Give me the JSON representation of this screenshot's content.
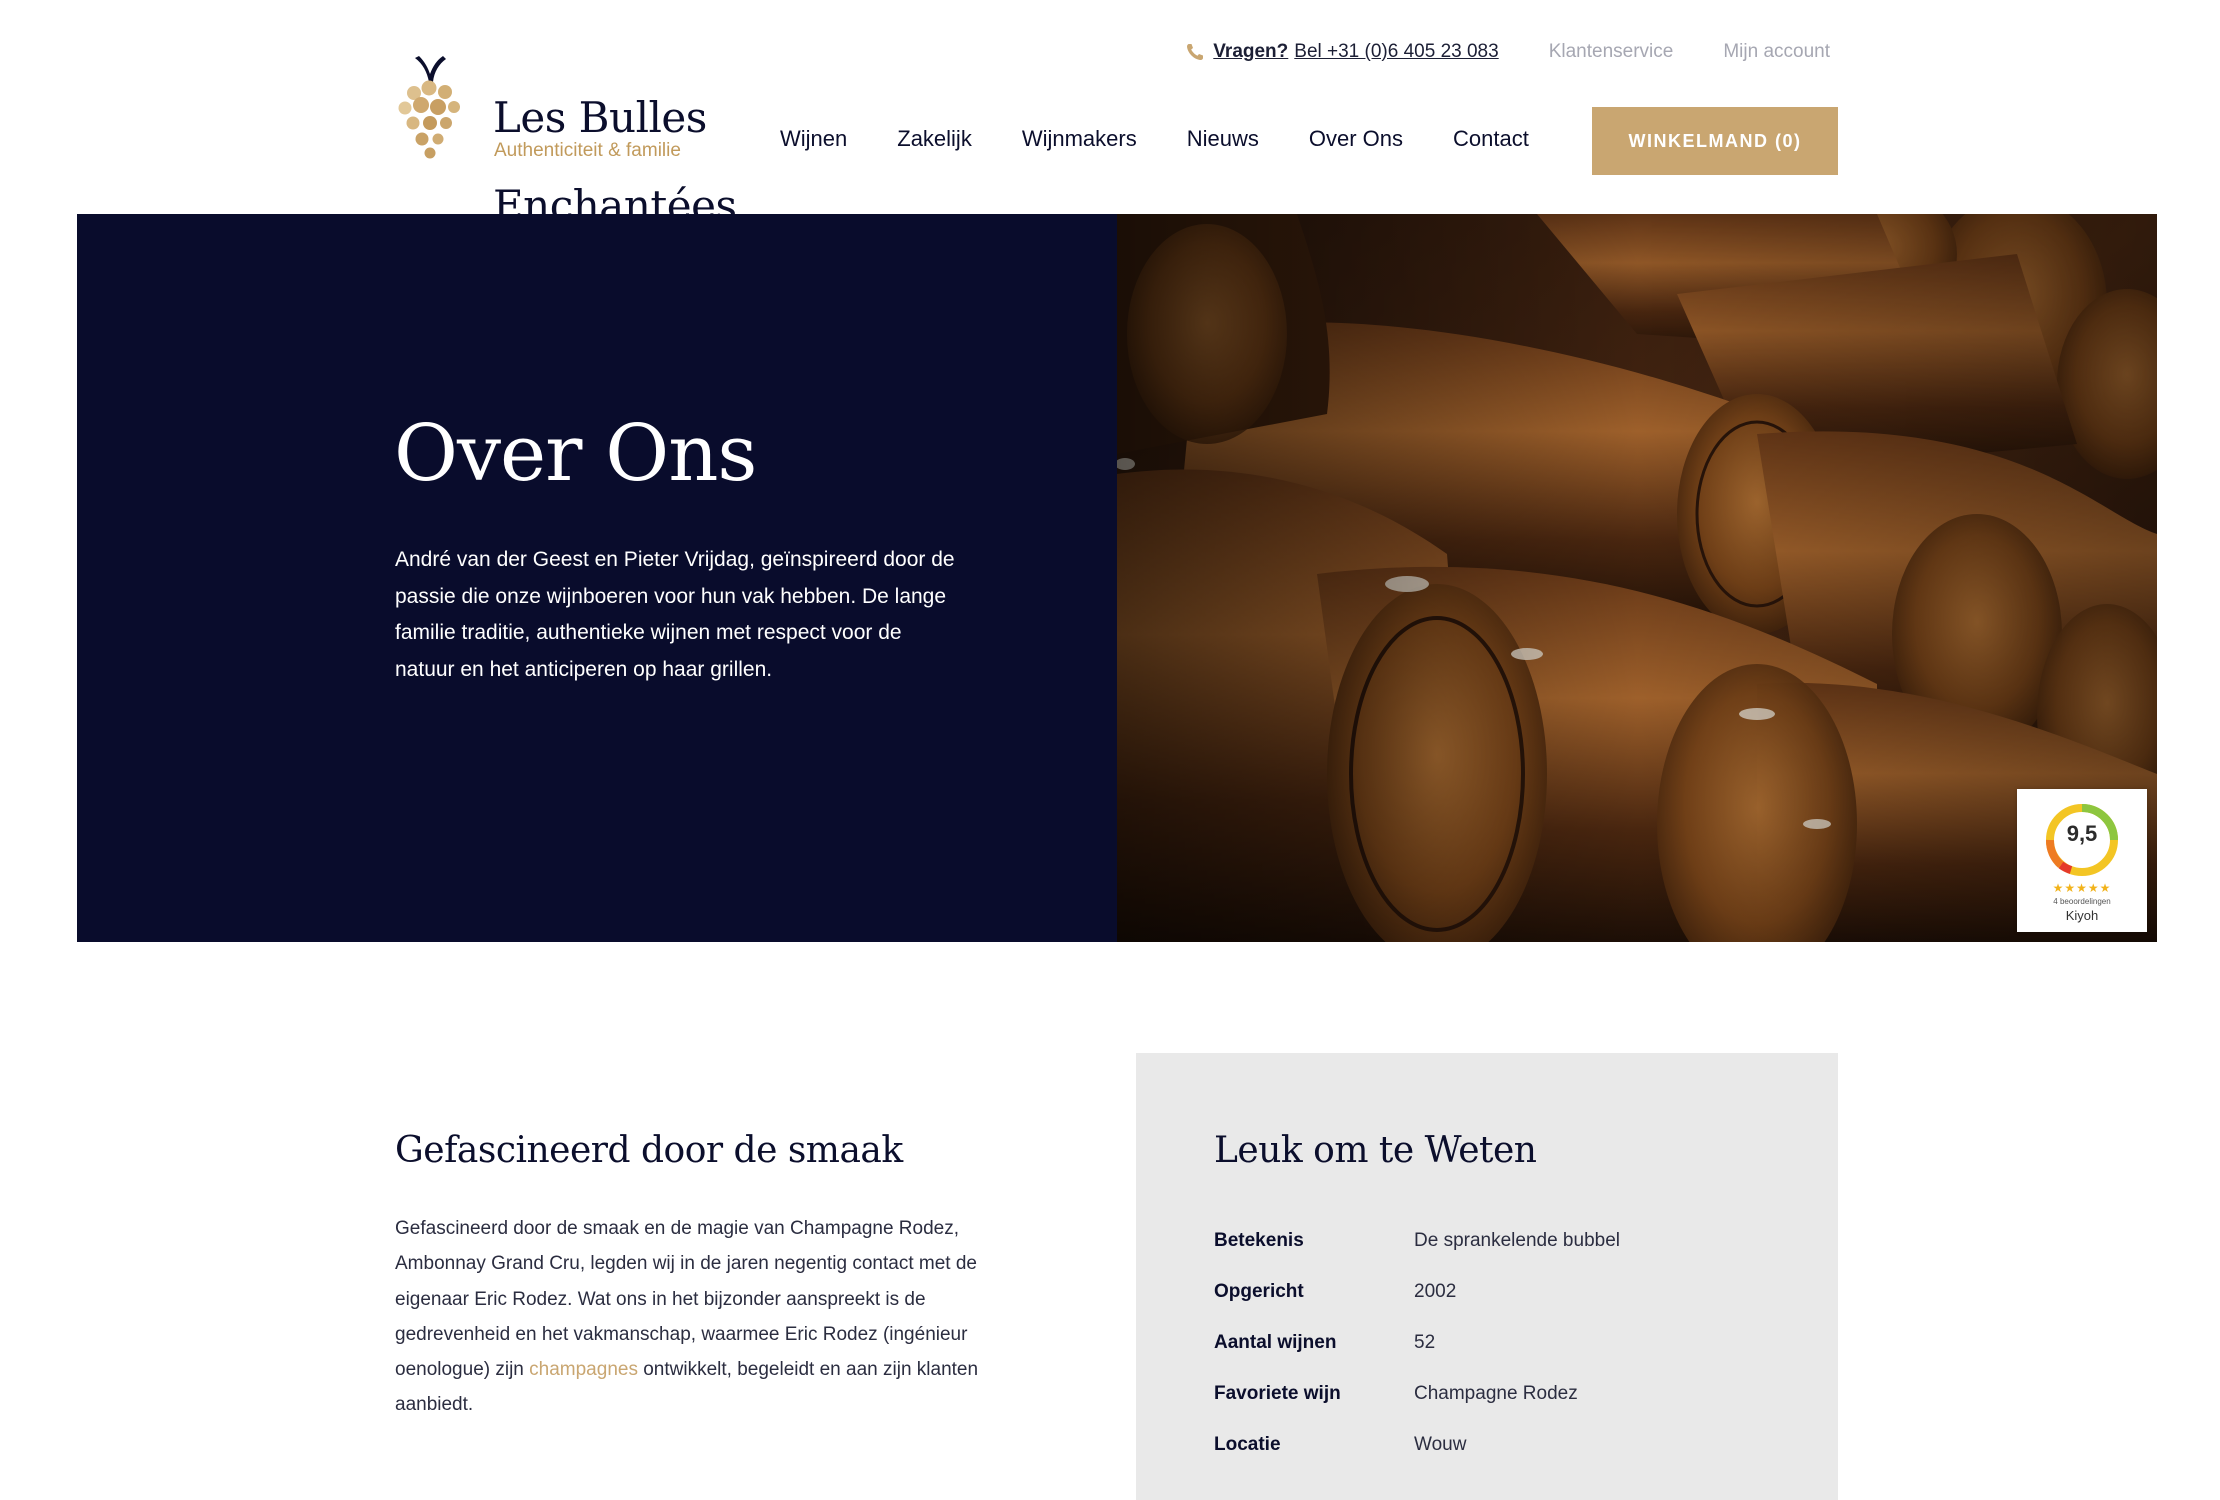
{
  "header": {
    "logo": {
      "name_line1": "Les Bulles",
      "name_line2": "Enchantées",
      "tagline": "Authenticiteit & familie"
    },
    "topbar": {
      "phone_prefix": "Vragen?",
      "phone_text": "Bel +31 (0)6 405 23 083",
      "links": [
        "Klantenservice",
        "Mijn account"
      ]
    },
    "nav": [
      "Wijnen",
      "Zakelijk",
      "Wijnmakers",
      "Nieuws",
      "Over Ons",
      "Contact"
    ],
    "cart_label": "WINKELMAND (0)"
  },
  "hero": {
    "title": "Over Ons",
    "text": "André van der Geest en Pieter Vrijdag, geïnspireerd door de passie die onze wijnboeren voor hun vak hebben. De lange familie traditie, authentieke wijnen met respect voor de natuur en het anticiperen op haar grillen."
  },
  "kiyoh": {
    "score": "9,5",
    "stars": "★★★★★",
    "count": "4 beoordelingen",
    "brand": "Kiyoh"
  },
  "about": {
    "title": "Gefascineerd door de smaak",
    "text_before": "Gefascineerd door de smaak en de magie van Champagne Rodez, Ambonnay Grand Cru, legden wij in de jaren negentig contact met de eigenaar Eric Rodez. Wat ons in het bijzonder aanspreekt is de gedrevenheid en het vakmanschap, waarmee Eric Rodez (ingénieur oenologue) zijn ",
    "link": "champagnes",
    "text_after": " ontwikkelt, begeleidt en aan zijn klanten aanbiedt."
  },
  "facts": {
    "title": "Leuk om te Weten",
    "rows": [
      {
        "key": "Betekenis",
        "value": "De sprankelende bubbel"
      },
      {
        "key": "Opgericht",
        "value": "2002"
      },
      {
        "key": "Aantal wijnen",
        "value": "52"
      },
      {
        "key": "Favoriete wijn",
        "value": "Champagne Rodez"
      },
      {
        "key": "Locatie",
        "value": "Wouw"
      }
    ]
  },
  "colors": {
    "navy": "#090c2c",
    "gold": "#c9a671",
    "facts_bg": "#e9e9e9"
  }
}
